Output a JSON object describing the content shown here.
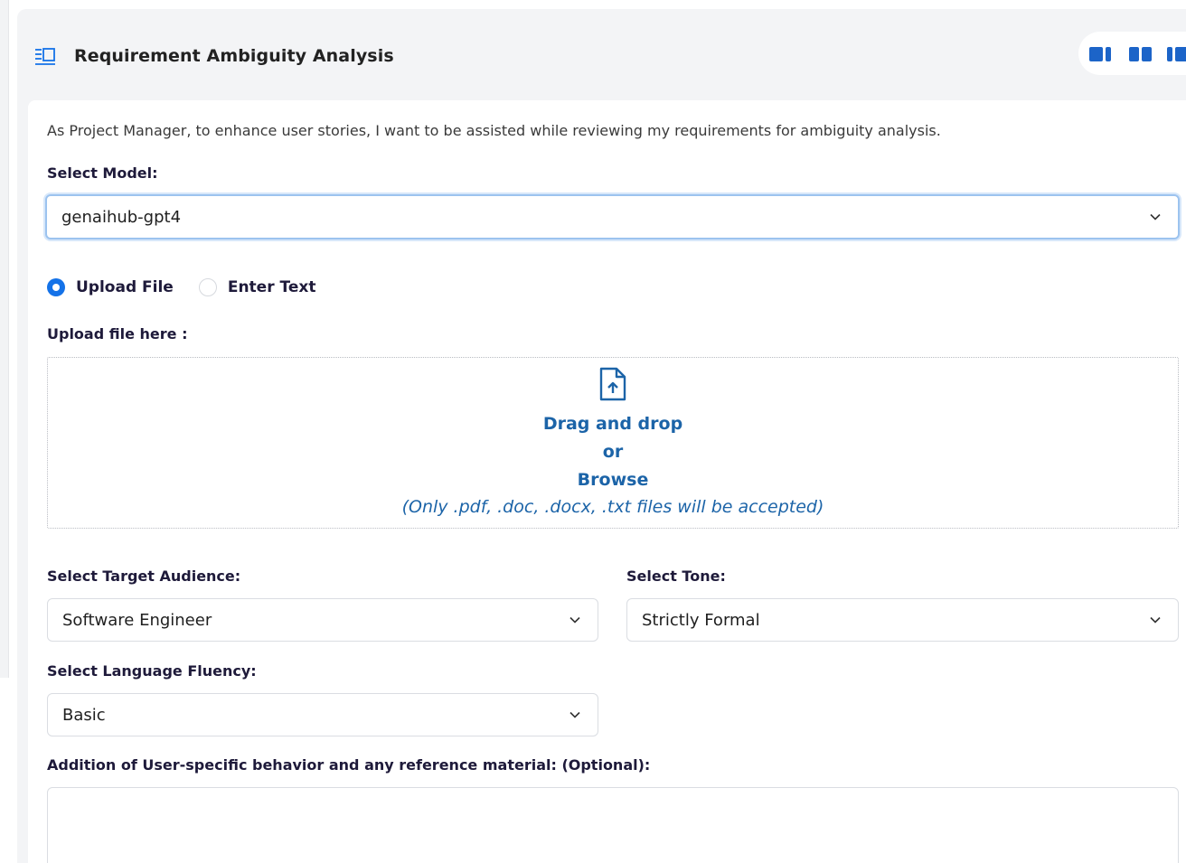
{
  "header": {
    "title": "Requirement Ambiguity Analysis",
    "icon": "panel-list-icon",
    "layout_buttons": [
      "layout-left-icon",
      "layout-split-icon",
      "layout-right-icon"
    ]
  },
  "description": "As Project Manager, to enhance user stories, I want to be assisted while reviewing my requirements for ambiguity analysis.",
  "model": {
    "label": "Select Model:",
    "value": "genaihub-gpt4"
  },
  "input_mode": {
    "options": [
      "Upload File",
      "Enter Text"
    ],
    "selected": "Upload File"
  },
  "upload": {
    "label": "Upload file here :",
    "drag_text": "Drag and drop",
    "or_text": "or",
    "browse_text": "Browse",
    "note": "(Only .pdf, .doc, .docx, .txt files will be accepted)"
  },
  "target_audience": {
    "label": "Select Target Audience:",
    "value": "Software Engineer"
  },
  "tone": {
    "label": "Select Tone:",
    "value": "Strictly Formal"
  },
  "fluency": {
    "label": "Select Language Fluency:",
    "value": "Basic"
  },
  "reference": {
    "label": "Addition of User-specific behavior and any reference material: (Optional):",
    "value": ""
  },
  "colors": {
    "accent": "#1472e8",
    "link": "#1c64a8",
    "panel_bg": "#f3f4f6",
    "label": "#1e1a3a"
  }
}
